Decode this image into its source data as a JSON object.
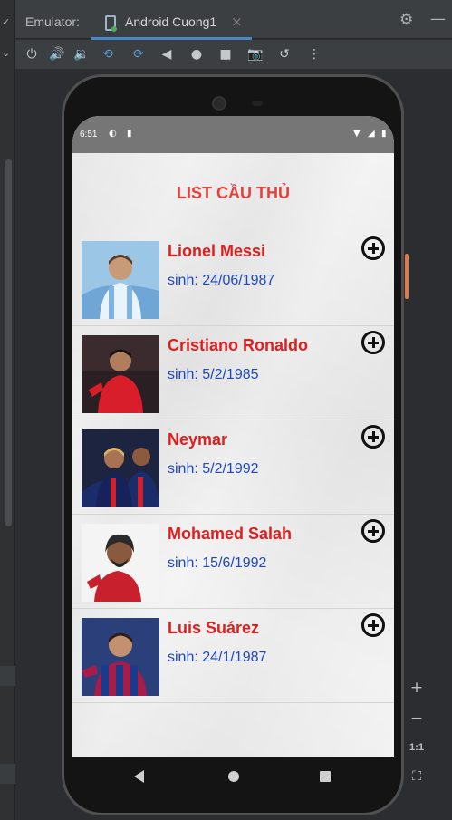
{
  "ide": {
    "emulator_label": "Emulator:",
    "tab_label": "Android Cuong1",
    "tab_close": "×",
    "icons": {
      "settings": "⚙",
      "minimize": "—"
    }
  },
  "toolbar": {
    "buttons": [
      {
        "name": "power-button",
        "glyph": "⏻"
      },
      {
        "name": "volume-up-button",
        "glyph": "🔊"
      },
      {
        "name": "volume-down-button",
        "glyph": "🔉"
      },
      {
        "name": "rotate-left-button",
        "glyph": "⟲"
      },
      {
        "name": "rotate-right-button",
        "glyph": "⟳"
      },
      {
        "name": "back-button",
        "glyph": "◀"
      },
      {
        "name": "home-button",
        "glyph": "●"
      },
      {
        "name": "overview-button",
        "glyph": "■"
      },
      {
        "name": "screenshot-button",
        "glyph": "📷"
      },
      {
        "name": "snapshot-button",
        "glyph": "↺"
      },
      {
        "name": "more-button",
        "glyph": "⋮"
      }
    ]
  },
  "side_panel": {
    "zoom_in": "+",
    "zoom_out": "−",
    "one_to_one": "1:1",
    "fit": "⛶"
  },
  "status_bar": {
    "time": "6:51"
  },
  "app": {
    "title": "LIST  CẦU THỦ",
    "players": [
      {
        "name": "Lionel Messi",
        "birth": "sinh: 24/06/1987"
      },
      {
        "name": "Cristiano Ronaldo",
        "birth": "sinh: 5/2/1985"
      },
      {
        "name": "Neymar",
        "birth": "sinh: 5/2/1992"
      },
      {
        "name": "Mohamed Salah",
        "birth": "sinh: 15/6/1992"
      },
      {
        "name": "Luis Suárez",
        "birth": "sinh: 24/1/1987"
      }
    ]
  },
  "colors": {
    "title": "#e5403b",
    "name": "#e01e1e",
    "birth": "#1f49b8",
    "tab_underline": "#4a88c7"
  }
}
